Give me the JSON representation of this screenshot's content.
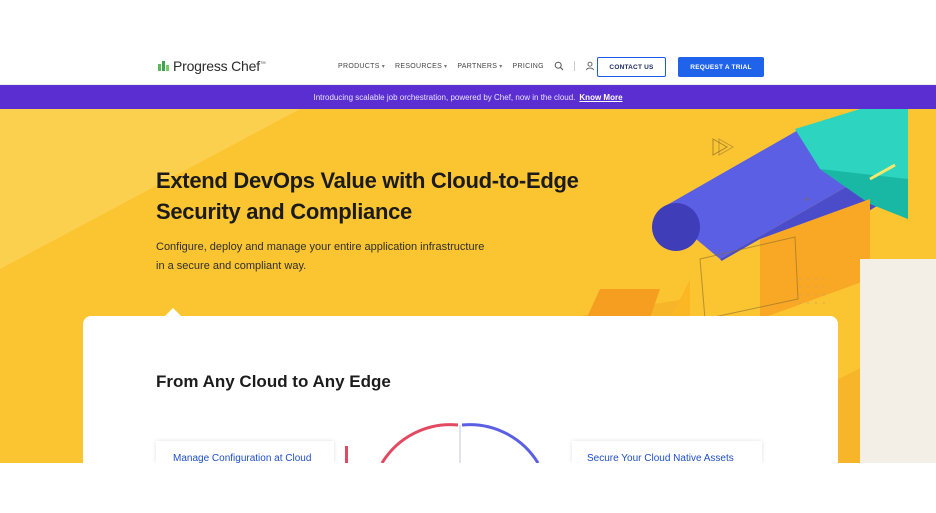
{
  "brand": {
    "name_part1": "Progress",
    "name_part2": "Chef",
    "trademark": "™",
    "logo_icon": "chef-logo-icon",
    "green": "#5cb85c"
  },
  "nav": {
    "items": [
      {
        "label": "PRODUCTS",
        "has_dropdown": true
      },
      {
        "label": "RESOURCES",
        "has_dropdown": true
      },
      {
        "label": "PARTNERS",
        "has_dropdown": true
      },
      {
        "label": "PRICING",
        "has_dropdown": false
      }
    ],
    "caret": "▾",
    "search_icon": "search-icon",
    "user_icon": "user-icon",
    "contact_label": "CONTACT US",
    "trial_label": "REQUEST A TRIAL"
  },
  "announcement": {
    "text": "Introducing scalable job orchestration, powered by Chef, now in the cloud.",
    "link": "Know More",
    "background": "#5b2ed1"
  },
  "hero": {
    "title_line1": "Extend DevOps Value with Cloud-to-Edge",
    "title_line2": "Security and Compliance",
    "subtitle_line1": "Configure, deploy and manage your entire application infrastructure",
    "subtitle_line2": "in a secure and compliant way.",
    "background": "#fbc532"
  },
  "section": {
    "title": "From Any Cloud to Any Edge",
    "feature_left": "Manage Configuration at Cloud",
    "feature_right": "Secure Your Cloud Native Assets"
  },
  "colors": {
    "primary_blue": "#1e63e9",
    "purple": "#5b2ed1",
    "teal": "#2dd4bf",
    "violet": "#5b5fe4",
    "orange": "#f7941d",
    "red": "#e24a62"
  }
}
